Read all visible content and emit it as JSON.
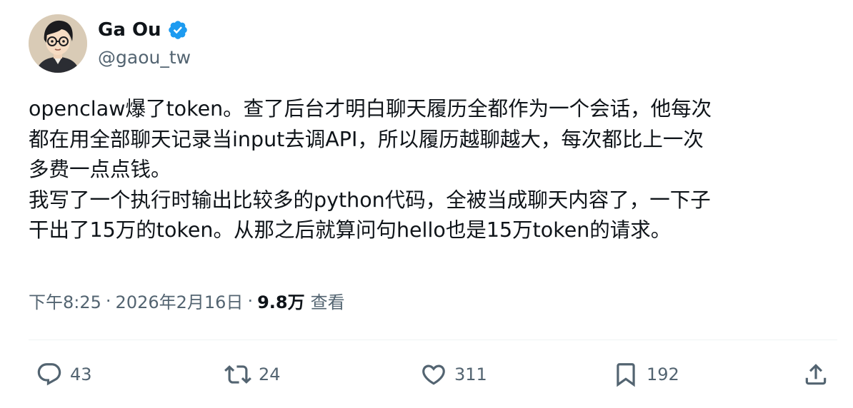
{
  "author": {
    "display_name": "Ga Ou",
    "handle": "@gaou_tw",
    "verified": true
  },
  "tweet": {
    "lines": [
      "openclaw爆了token。查了后台才明白聊天履历全都作为一个会话，他每次",
      "都在用全部聊天记录当input去调API，所以履历越聊越大，每次都比上一次",
      "多费一点点钱。",
      "我写了一个执行时输出比较多的python代码，全被当成聊天内容了，一下子",
      "干出了15万的token。从那之后就算问句hello也是15万token的请求。"
    ]
  },
  "meta": {
    "time": "下午8:25",
    "separator": "·",
    "date": "2026年2月16日",
    "views_count": "9.8万",
    "views_label": "查看"
  },
  "actions": {
    "reply_count": "43",
    "retweet_count": "24",
    "like_count": "311",
    "bookmark_count": "192"
  },
  "colors": {
    "text_primary": "#0f1419",
    "text_secondary": "#536471",
    "verified_blue": "#1d9bf0",
    "divider": "#eff3f4"
  },
  "icons": {
    "reply": "speech-bubble-icon",
    "retweet": "retweet-arrows-icon",
    "like": "heart-icon",
    "bookmark": "bookmark-icon",
    "share": "share-upload-icon",
    "verified": "verified-badge-icon"
  }
}
